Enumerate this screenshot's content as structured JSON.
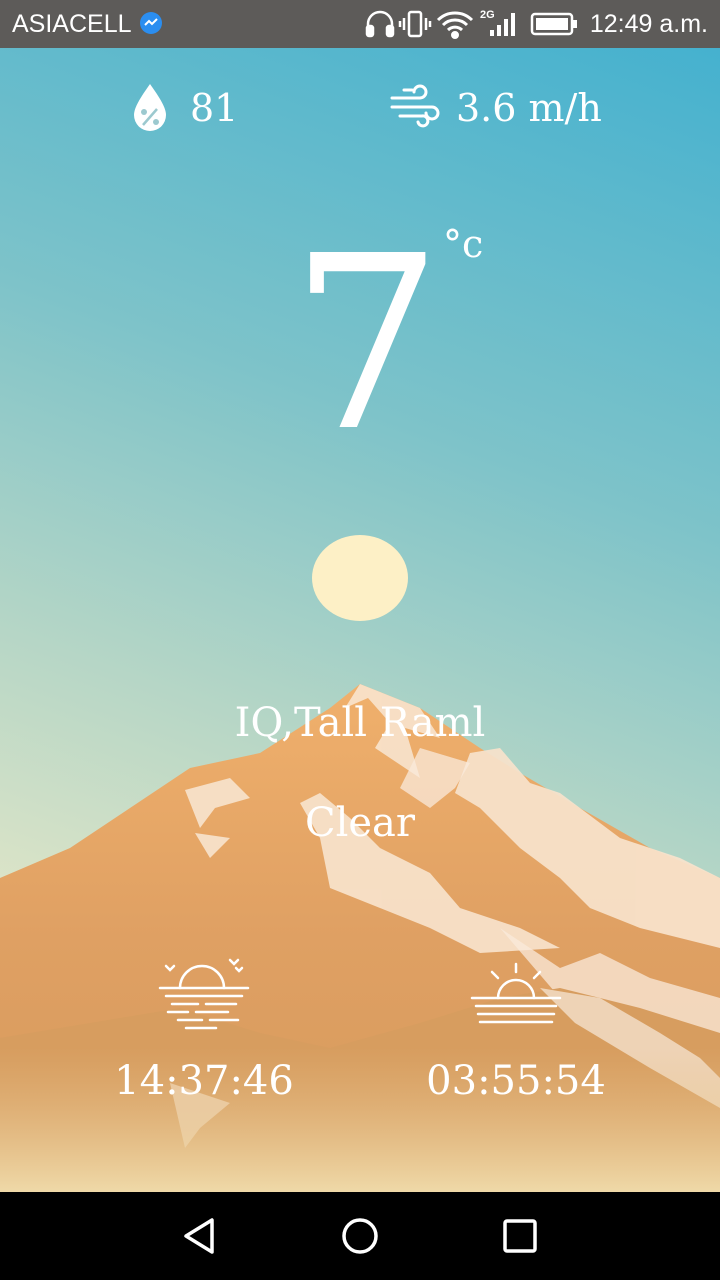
{
  "status_bar": {
    "carrier": "ASIACELL",
    "network": "2G",
    "time": "12:49 a.m."
  },
  "weather": {
    "humidity": "81",
    "wind": "3.6 m/h",
    "temperature": "7",
    "unit": "°c",
    "location": "IQ,Tall Raml",
    "condition": "Clear",
    "sunset_time": "14:37:46",
    "sunrise_time": "03:55:54"
  },
  "icons": {
    "humidity": "humidity-drop-icon",
    "wind": "wind-icon",
    "sunset": "sunset-icon",
    "sunrise": "sunrise-icon"
  },
  "nav": [
    "back",
    "home",
    "recents"
  ]
}
